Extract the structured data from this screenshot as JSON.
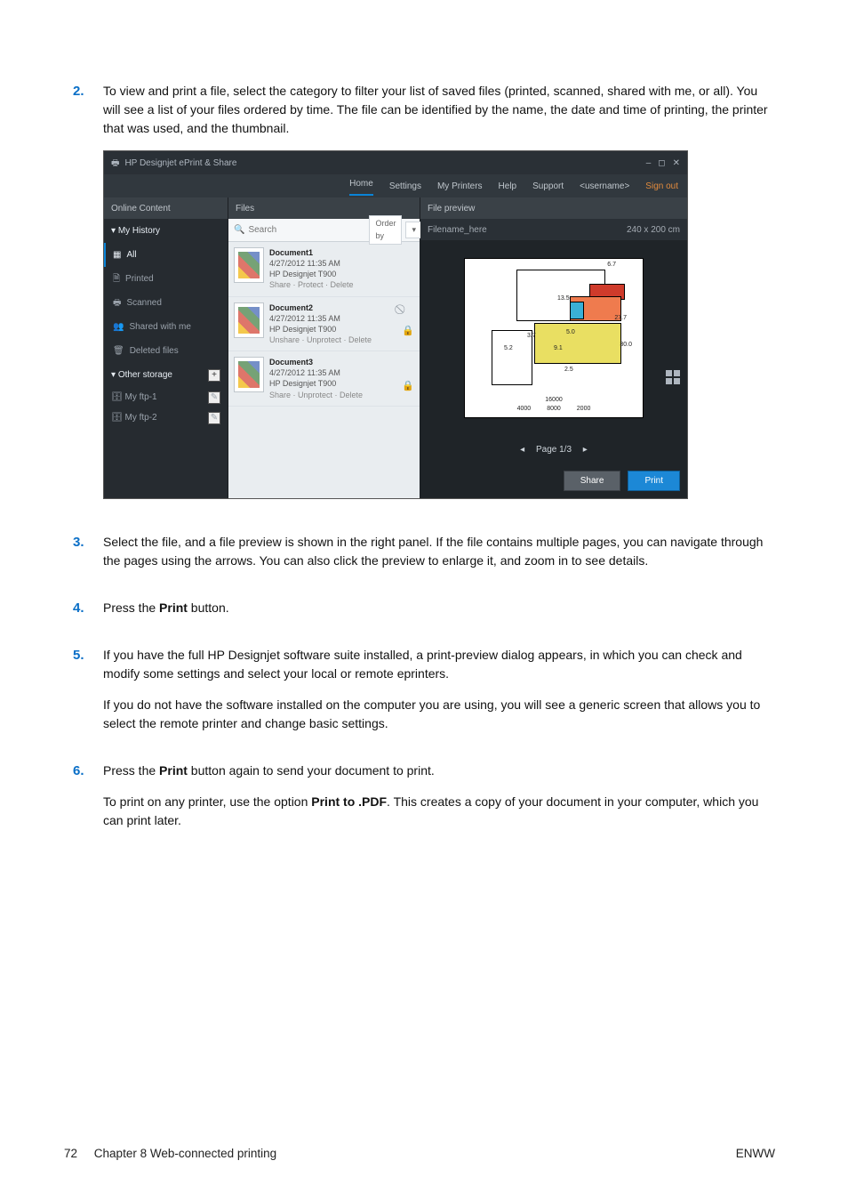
{
  "steps": {
    "s2": {
      "num": "2.",
      "text": "To view and print a file, select the category to filter your list of saved files (printed, scanned, shared with me, or all). You will see a list of your files ordered by time. The file can be identified by the name, the date and time of printing, the printer that was used, and the thumbnail."
    },
    "s3": {
      "num": "3.",
      "text": "Select the file, and a file preview is shown in the right panel. If the file contains multiple pages, you can navigate through the pages using the arrows. You can also click the preview to enlarge it, and zoom in to see details."
    },
    "s4": {
      "num": "4.",
      "text_a": "Press the ",
      "text_b": "Print",
      "text_c": " button."
    },
    "s5": {
      "num": "5.",
      "p1": "If you have the full HP Designjet software suite installed, a print-preview dialog appears, in which you can check and modify some settings and select your local or remote eprinters.",
      "p2": "If you do not have the software installed on the computer you are using, you will see a generic screen that allows you to select the remote printer and change basic settings."
    },
    "s6": {
      "num": "6.",
      "p1_a": "Press the ",
      "p1_b": "Print",
      "p1_c": " button again to send your document to print.",
      "p2_a": "To print on any printer, use the option ",
      "p2_b": "Print to .PDF",
      "p2_c": ". This creates a copy of your document in your computer, which you can print later."
    }
  },
  "footer": {
    "page": "72",
    "chapter": "Chapter 8   Web-connected printing",
    "brand": "ENWW"
  },
  "app": {
    "title": "HP Designjet ePrint & Share",
    "window": {
      "min": "–",
      "max": "◻",
      "close": "✕"
    },
    "menu": {
      "home": "Home",
      "settings": "Settings",
      "myprinters": "My Printers",
      "help": "Help",
      "support": "Support",
      "user": "<username>",
      "signout": "Sign out"
    },
    "cols": {
      "left": "Online Content",
      "mid": "Files",
      "right": "File preview"
    },
    "sidebar": {
      "history": "My History",
      "all": "All",
      "printed": "Printed",
      "scanned": "Scanned",
      "shared": "Shared with me",
      "deleted": "Deleted files",
      "other": "Other storage",
      "plus": "+",
      "ftp1": "My ftp-1",
      "ftp2": "My ftp-2",
      "pencil": "✎"
    },
    "search": {
      "placeholder": "Search",
      "orderby": "Order by",
      "caret": "▾"
    },
    "files": [
      {
        "name": "Document1",
        "date": "4/27/2012 11:35 AM",
        "printer": "HP Designjet T900",
        "actions": "Share  ·  Protect  ·  Delete"
      },
      {
        "name": "Document2",
        "date": "4/27/2012 11:35 AM",
        "printer": "HP Designjet T900",
        "actions": "Unshare  ·  Unprotect  ·  Delete",
        "unshare_icon": "⃠",
        "lock_icon": "🔒"
      },
      {
        "name": "Document3",
        "date": "4/27/2012 11:35 AM",
        "printer": "HP Designjet T900",
        "actions": "Share  ·  Unprotect  ·  Delete",
        "lock_icon": "🔒"
      }
    ],
    "preview": {
      "filename": "Filename_here",
      "size": "240 x 200 cm",
      "dims": {
        "a": "6.7",
        "b": "13.5",
        "c": "3.7",
        "d": "5.0",
        "e": "5.2",
        "f": "9.1",
        "g": "2.5",
        "h": "27.7",
        "i": "30.0"
      },
      "scale": {
        "l": "4000",
        "m": "16000",
        "r": "2000",
        "c": "8000"
      },
      "pager": {
        "prev": "◂",
        "label": "Page 1/3",
        "next": "▸"
      },
      "buttons": {
        "share": "Share",
        "print": "Print"
      }
    }
  }
}
